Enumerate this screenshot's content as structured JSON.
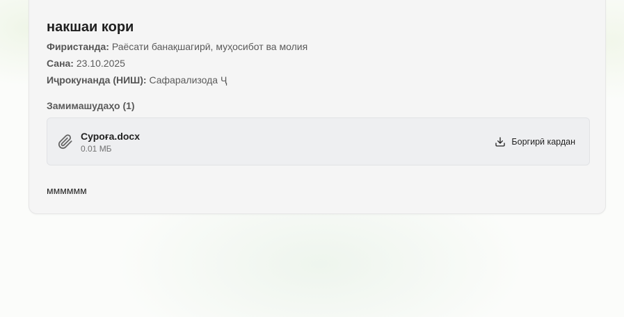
{
  "card": {
    "title": "накшаи кори",
    "sender_label": "Фиристанда:",
    "sender_value": "Раёсати банақшагирӣ, муҳосибот ва молия",
    "date_label": "Сана:",
    "date_value": "23.10.2025",
    "executor_label": "Иҷрокунанда (НИШ):",
    "executor_value": "Сафарализода Ҷ",
    "attachments_heading": "Замимашудаҳо (1)",
    "attachments": [
      {
        "icon": "paperclip-icon",
        "name": "Суроға.docx",
        "size": "0.01 МБ",
        "download_icon": "download-icon",
        "download_label": "Боргирӣ кардан"
      }
    ],
    "body_text": "мммммм"
  }
}
